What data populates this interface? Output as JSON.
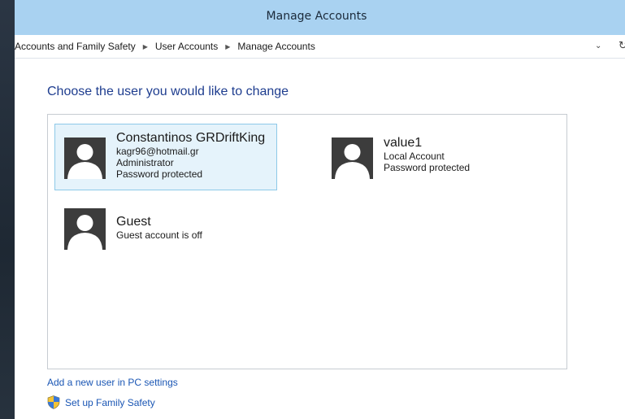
{
  "window": {
    "title": "Manage Accounts"
  },
  "address": {
    "crumbs": [
      "Accounts and Family Safety",
      "User Accounts",
      "Manage Accounts"
    ],
    "dropdown_icon": "chevron-down-icon",
    "refresh_icon": "refresh-icon"
  },
  "main": {
    "heading": "Choose the user you would like to change",
    "accounts": [
      {
        "name": "Constantinos GRDriftKing",
        "lines": [
          "kagr96@hotmail.gr",
          "Administrator",
          "Password protected"
        ],
        "selected": true
      },
      {
        "name": "value1",
        "lines": [
          "Local Account",
          "Password protected"
        ],
        "selected": false
      },
      {
        "name": "Guest",
        "lines": [
          "Guest account is off"
        ],
        "selected": false
      }
    ]
  },
  "links": {
    "add_user": "Add a new user in PC settings",
    "family_safety": "Set up Family Safety"
  },
  "colors": {
    "titlebar": "#a9d2f1",
    "heading": "#1e3d8f",
    "link": "#1a56b4",
    "selected_bg": "#e5f3fb",
    "selected_border": "#8ec9e8"
  }
}
